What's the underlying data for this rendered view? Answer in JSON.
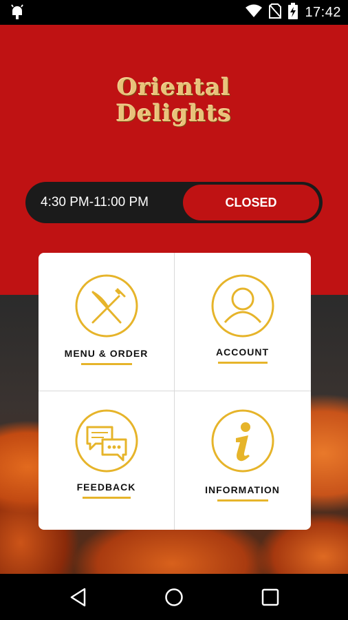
{
  "status_bar": {
    "time": "17:42",
    "icons": [
      "android-debug-icon",
      "wifi-icon",
      "no-sim-icon",
      "battery-charging-icon"
    ]
  },
  "brand": {
    "line1": "Oriental",
    "line2": "Delights"
  },
  "hours": {
    "range": "4:30 PM-11:00 PM",
    "status": "CLOSED"
  },
  "tiles": [
    {
      "label": "MENU & ORDER",
      "icon": "knife-fork-icon"
    },
    {
      "label": "ACCOUNT",
      "icon": "user-icon"
    },
    {
      "label": "FEEDBACK",
      "icon": "chat-bubbles-icon"
    },
    {
      "label": "INFORMATION",
      "icon": "info-icon"
    }
  ],
  "colors": {
    "brand_red": "#bf1213",
    "accent_gold": "#e6b42a",
    "logo_gold": "#e8c27a"
  },
  "nav": [
    "back-icon",
    "home-icon",
    "recents-icon"
  ]
}
